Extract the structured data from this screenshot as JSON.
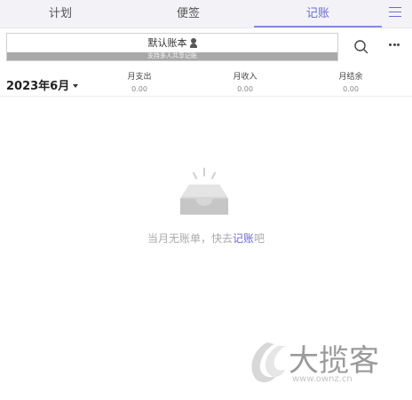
{
  "tabs": [
    {
      "label": "计划"
    },
    {
      "label": "便签"
    },
    {
      "label": "记账"
    }
  ],
  "ledger": {
    "name": "默认账本",
    "hint": "支持多人共享记账"
  },
  "summary": {
    "month": "2023年6月",
    "expense": {
      "label": "月支出",
      "value": "0.00"
    },
    "income": {
      "label": "月收入",
      "value": "0.00"
    },
    "balance": {
      "label": "月结余",
      "value": "0.00"
    }
  },
  "empty": {
    "prefix": "当月无账单，快去",
    "link": "记账",
    "suffix": "吧"
  },
  "watermark": {
    "text": "大揽客",
    "sub": "www.ownz.cn"
  },
  "colors": {
    "accent": "#6b6bd6",
    "tabbar": "#f3f3f7"
  }
}
